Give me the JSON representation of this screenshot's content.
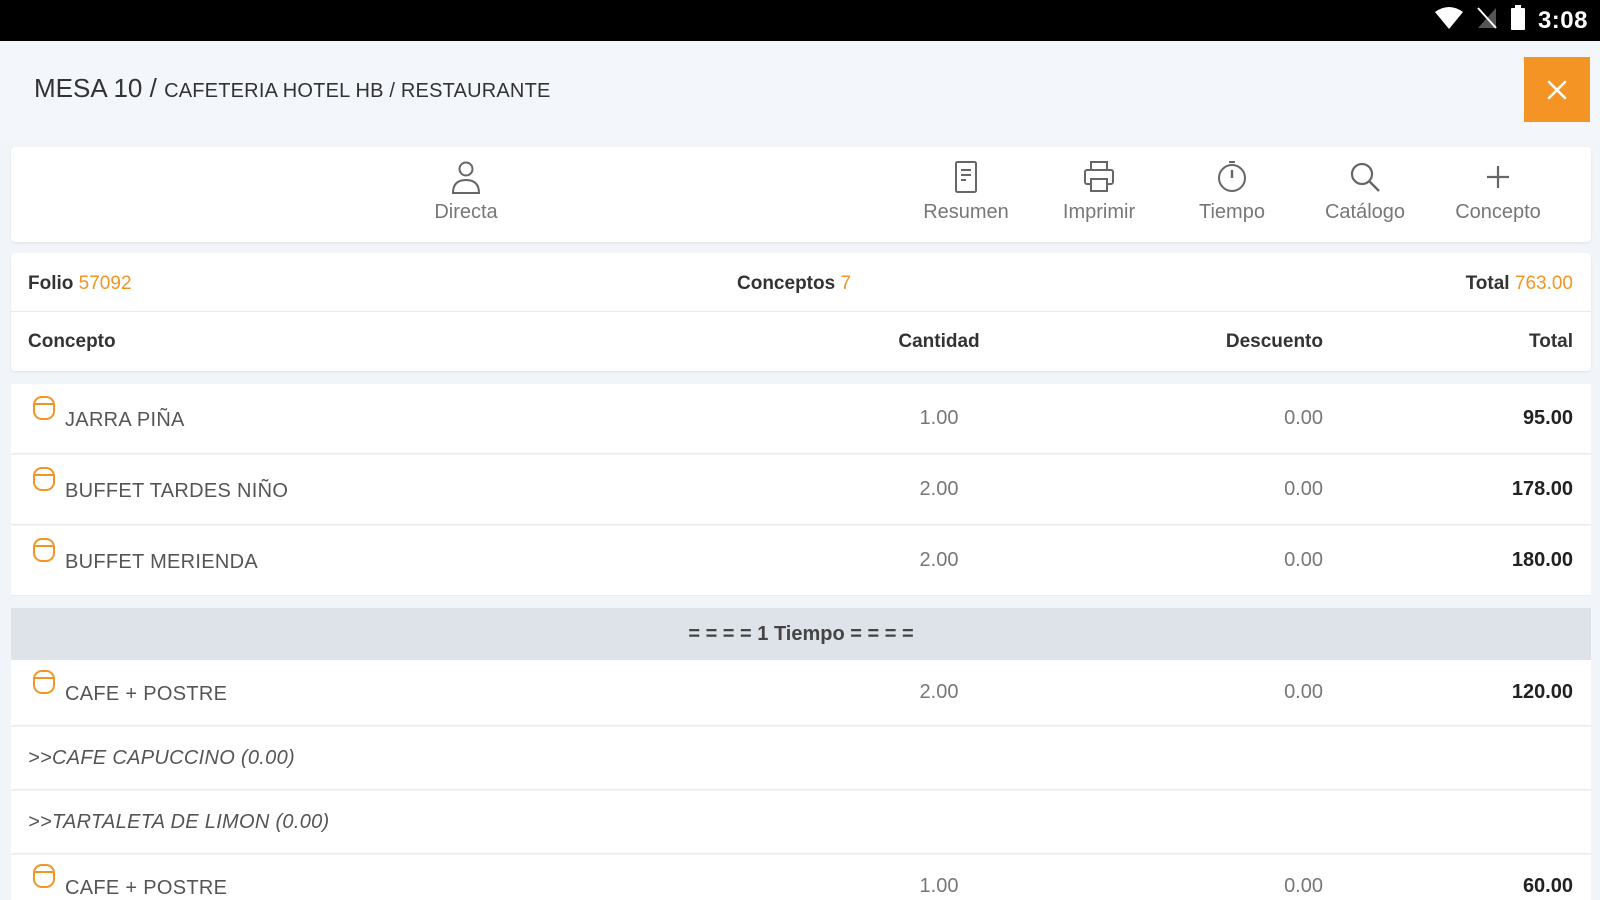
{
  "statusbar": {
    "time": "3:08"
  },
  "header": {
    "mesa": "MESA 10",
    "separator": " / ",
    "subtitle": "CAFETERIA HOTEL HB / RESTAURANTE",
    "close_label": "×"
  },
  "toolbar": {
    "directa": "Directa",
    "resumen": "Resumen",
    "imprimir": "Imprimir",
    "tiempo": "Tiempo",
    "catalogo": "Catálogo",
    "concepto": "Concepto"
  },
  "summary": {
    "folio_label": "Folio",
    "folio_value": "57092",
    "conceptos_label": "Conceptos",
    "conceptos_value": "7",
    "total_label": "Total",
    "total_value": "763.00"
  },
  "columns": {
    "concepto": "Concepto",
    "cantidad": "Cantidad",
    "descuento": "Descuento",
    "total": "Total"
  },
  "items": [
    {
      "name": "JARRA PIÑA",
      "qty": "1.00",
      "discount": "0.00",
      "total": "95.00"
    },
    {
      "name": "BUFFET TARDES NIÑO",
      "qty": "2.00",
      "discount": "0.00",
      "total": "178.00"
    },
    {
      "name": "BUFFET MERIENDA",
      "qty": "2.00",
      "discount": "0.00",
      "total": "180.00"
    }
  ],
  "tiempo_separator": "= = = = 1 Tiempo = = = =",
  "items_after": [
    {
      "name": "CAFE + POSTRE",
      "qty": "2.00",
      "discount": "0.00",
      "total": "120.00"
    },
    {
      "name": ">>CAFE CAPUCCINO (0.00)"
    },
    {
      "name": ">>TARTALETA DE LIMON (0.00)"
    },
    {
      "name": "CAFE + POSTRE",
      "qty": "1.00",
      "discount": "0.00",
      "total": "60.00"
    }
  ],
  "colors": {
    "accent": "#f39425",
    "tiempo_bg": "#dde3e9"
  }
}
